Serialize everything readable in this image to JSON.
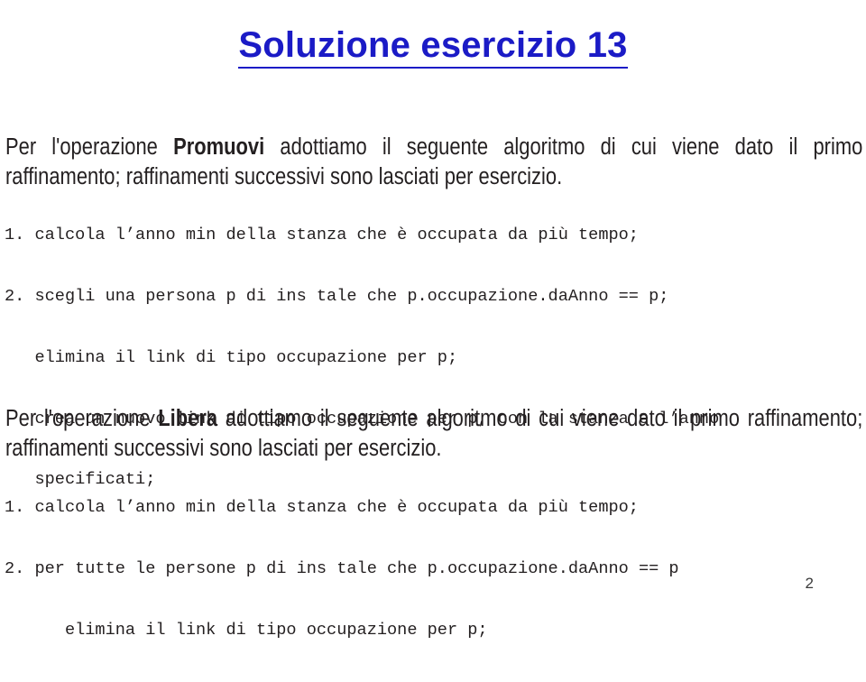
{
  "slide": {
    "title": "Soluzione esercizio 13",
    "title_color": "#1b1bc6",
    "text_color": "#231f20",
    "background_color": "#ffffff",
    "page_number": "2"
  },
  "sections": [
    {
      "id": "promuovi",
      "paragraph": {
        "prefix": "Per l'operazione ",
        "emphasis": "Promuovi",
        "suffix": " adottiamo il seguente algoritmo di cui viene dato il primo raffinamento; raffinamenti successivi sono lasciati per esercizio.",
        "line1": "Per l'operazione Promuovi adottiamo il seguente algoritmo di cui viene da-",
        "line2": "to il primo raffinamento; raffinamenti successivi sono lasciati per esercizio."
      },
      "code_lines": [
        "1. calcola l’anno min della stanza che è occupata da più tempo;",
        "2. scegli una persona p di ins tale che p.occupazione.daAnno == p;",
        "   elimina il link di tipo occupazione per p;",
        "   crea un nuovo link di tipo occupazione per p, con la stanza e l’anno",
        "   specificati;"
      ]
    },
    {
      "id": "libera",
      "paragraph": {
        "prefix": "Per l'operazione ",
        "emphasis": "Libera",
        "suffix": " adottiamo il seguente algoritmo di cui viene dato il primo raffinamento; raffinamenti successivi sono lasciati per esercizio.",
        "line1": "Per l'operazione Libera adottiamo il seguente algoritmo di cui viene dato",
        "line2": "il primo raffinamento; raffinamenti successivi sono lasciati per esercizio."
      },
      "code_lines": [
        "1. calcola l’anno min della stanza che è occupata da più tempo;",
        "2. per tutte le persone p di ins tale che p.occupazione.daAnno == p",
        "      elimina il link di tipo occupazione per p;"
      ]
    }
  ]
}
